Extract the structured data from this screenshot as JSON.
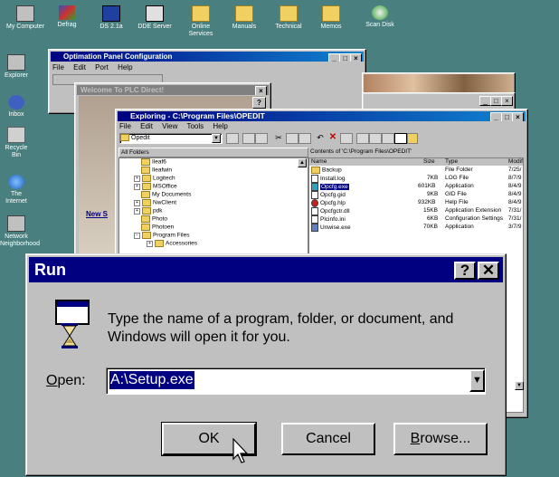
{
  "desktop": {
    "top_icons": [
      {
        "label": "My Computer",
        "icon": "computer-icon"
      },
      {
        "label": "Defrag",
        "icon": "defrag-icon"
      },
      {
        "label": "DS 2.1a",
        "icon": "ds-icon"
      },
      {
        "label": "DDE Server",
        "icon": "server-icon"
      },
      {
        "label": "Online Services",
        "icon": "folder-icon"
      },
      {
        "label": "Manuals",
        "icon": "folder-icon"
      },
      {
        "label": "Technical",
        "icon": "folder-icon"
      },
      {
        "label": "Memos",
        "icon": "folder-icon"
      },
      {
        "label": "Scan Disk",
        "icon": "scandisk-icon"
      }
    ],
    "left_icons": [
      {
        "label": "Explorer"
      },
      {
        "label": "Inbox"
      },
      {
        "label": "Recycle Bin"
      },
      {
        "label": "The Internet"
      },
      {
        "label": "Network Neighborhood"
      }
    ]
  },
  "optimation_window": {
    "title": "Optimation Panel Configuration",
    "menu": [
      "File",
      "Edit",
      "Port",
      "Help"
    ]
  },
  "welcome_window": {
    "title": "Welcome To PLC Direct!",
    "button": "New S"
  },
  "explorer": {
    "title": "Exploring - C:\\Program Files\\OPEDIT",
    "menu": [
      "File",
      "Edit",
      "View",
      "Tools",
      "Help"
    ],
    "folder_combo": "Opedit",
    "all_folders_label": "All Folders",
    "contents_label": "Contents of 'C:\\Program Files\\OPEDIT'",
    "tree": [
      "Ileaf6",
      "Ileafwin",
      "Logitech",
      "MSOffice",
      "My Documents",
      "NwClient",
      "pdk",
      "Photo",
      "Photoen",
      "Program Files",
      "Accessories"
    ],
    "columns": [
      "Name",
      "Size",
      "Type",
      "Modif"
    ],
    "files": [
      {
        "name": "Backup",
        "size": "",
        "type": "File Folder",
        "mod": "7/25/"
      },
      {
        "name": "Install.log",
        "size": "7KB",
        "type": "LOG File",
        "mod": "8/7/9"
      },
      {
        "name": "Opcfg.exe",
        "size": "601KB",
        "type": "Application",
        "mod": "8/4/9"
      },
      {
        "name": "Opcfg.gid",
        "size": "9KB",
        "type": "GID File",
        "mod": "8/4/9"
      },
      {
        "name": "Opcfg.hlp",
        "size": "932KB",
        "type": "Help File",
        "mod": "8/4/9"
      },
      {
        "name": "Opcfgctr.dll",
        "size": "15KB",
        "type": "Application Extension",
        "mod": "7/31/"
      },
      {
        "name": "Plcinfo.ini",
        "size": "6KB",
        "type": "Configuration Settings",
        "mod": "7/31/"
      },
      {
        "name": "Unwise.exe",
        "size": "70KB",
        "type": "Application",
        "mod": "3/7/9"
      }
    ]
  },
  "run_dialog": {
    "title": "Run",
    "help_glyph": "?",
    "close_glyph": "✕",
    "message": "Type the name of a program, folder, or document, and Windows will open it for you.",
    "open_label": "Open:",
    "open_value": "A:\\Setup.exe",
    "ok": "OK",
    "cancel": "Cancel",
    "browse": "Browse..."
  }
}
